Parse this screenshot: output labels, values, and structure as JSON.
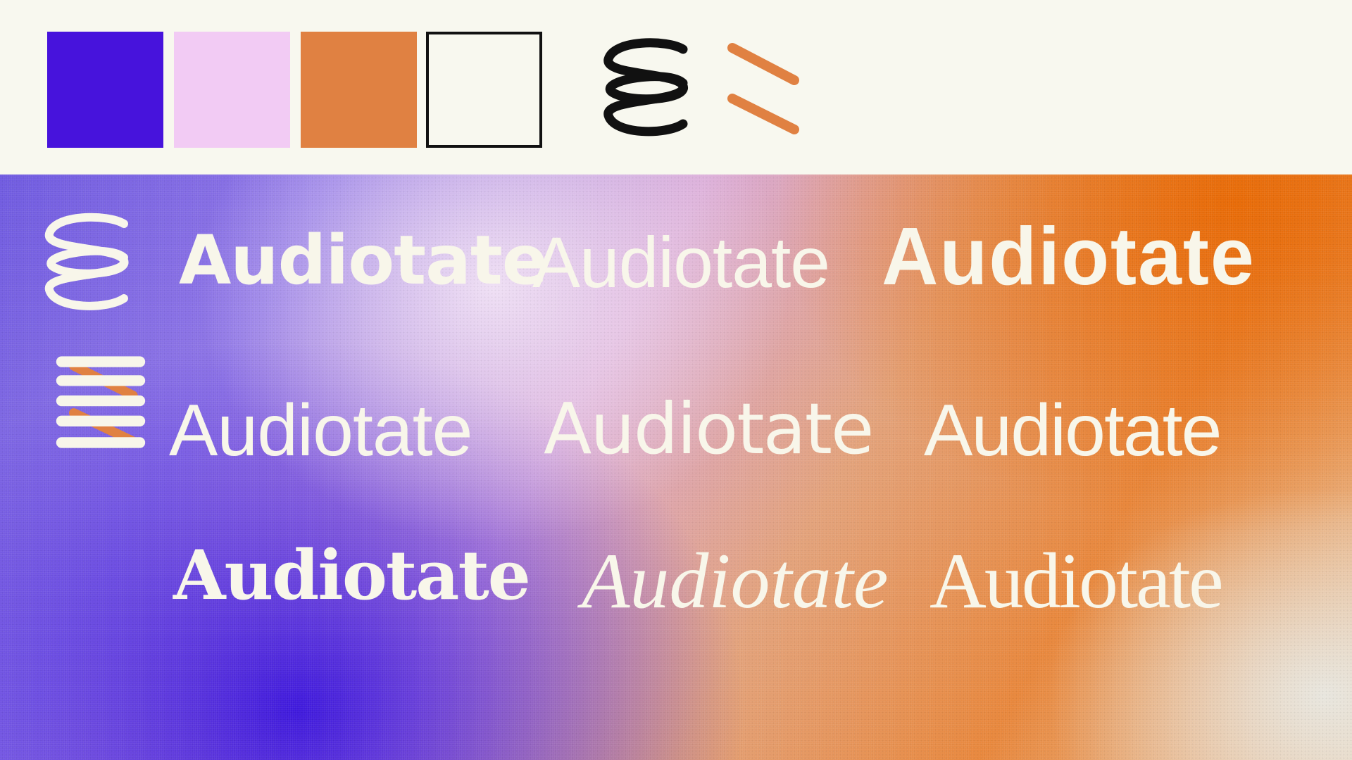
{
  "palette": {
    "swatches": [
      {
        "name": "indigo",
        "color": "#4713dc"
      },
      {
        "name": "lilac",
        "color": "#f2cbf4"
      },
      {
        "name": "orange",
        "color": "#e08142"
      },
      {
        "name": "cream",
        "color": "#f8f8ef"
      }
    ],
    "outline_color": "#111111"
  },
  "logos": {
    "top": [
      {
        "icon": "coil-logo-icon",
        "style": "black outline"
      },
      {
        "icon": "zigzag-logo-icon",
        "style": "purple gradient with orange"
      }
    ],
    "showcase": [
      {
        "icon": "coil-logo-icon",
        "style": "cream outline"
      },
      {
        "icon": "zigzag-logo-icon",
        "style": "cream with orange"
      }
    ]
  },
  "colors": {
    "text": "#f8f6ea",
    "gradient_blue": "#3e18dc",
    "gradient_orange": "#e86a06",
    "gradient_pink": "#d9a8d6"
  },
  "wordmarks": {
    "row1": [
      "Audiotate",
      "Audiotate",
      "Audiotate"
    ],
    "row2": [
      "Audiotate",
      "Audiotate",
      "Audiotate"
    ],
    "row3": [
      "Audiotate",
      "Audiotate",
      "Audiotate"
    ]
  }
}
